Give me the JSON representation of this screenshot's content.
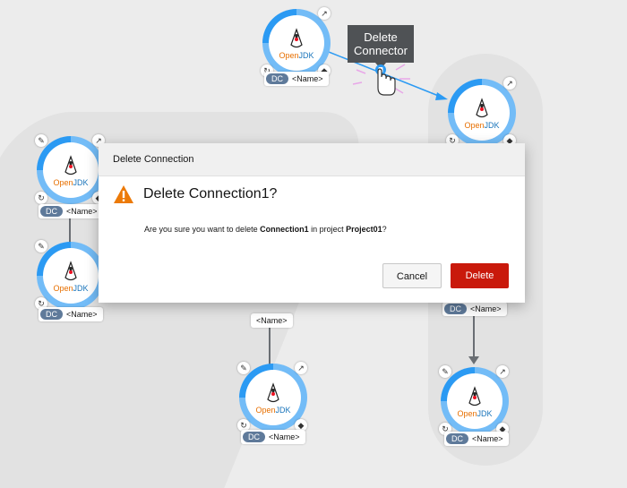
{
  "tooltip": {
    "text": "Delete Connector"
  },
  "node_label": {
    "badge": "DC",
    "name": "<Name>"
  },
  "logo": {
    "open": "Open",
    "jdk": "JDK"
  },
  "modal": {
    "header": "Delete Connection",
    "title": "Delete Connection1?",
    "body_prefix": "Are you sure you want to delete ",
    "connection_name": "Connection1",
    "body_middle": " in project ",
    "project_name": "Project01",
    "body_suffix": "?",
    "cancel_label": "Cancel",
    "delete_label": "Delete"
  },
  "colors": {
    "ring_light": "#73bcf7",
    "ring_dark": "#2b9af3",
    "delete": "#c9190b",
    "tooltip_bg": "#4f5255",
    "warning": "#f0ab00"
  },
  "icons": [
    "pencil-icon",
    "external-link-icon",
    "refresh-icon",
    "git-icon",
    "warning-icon",
    "pointer-hand-icon"
  ]
}
